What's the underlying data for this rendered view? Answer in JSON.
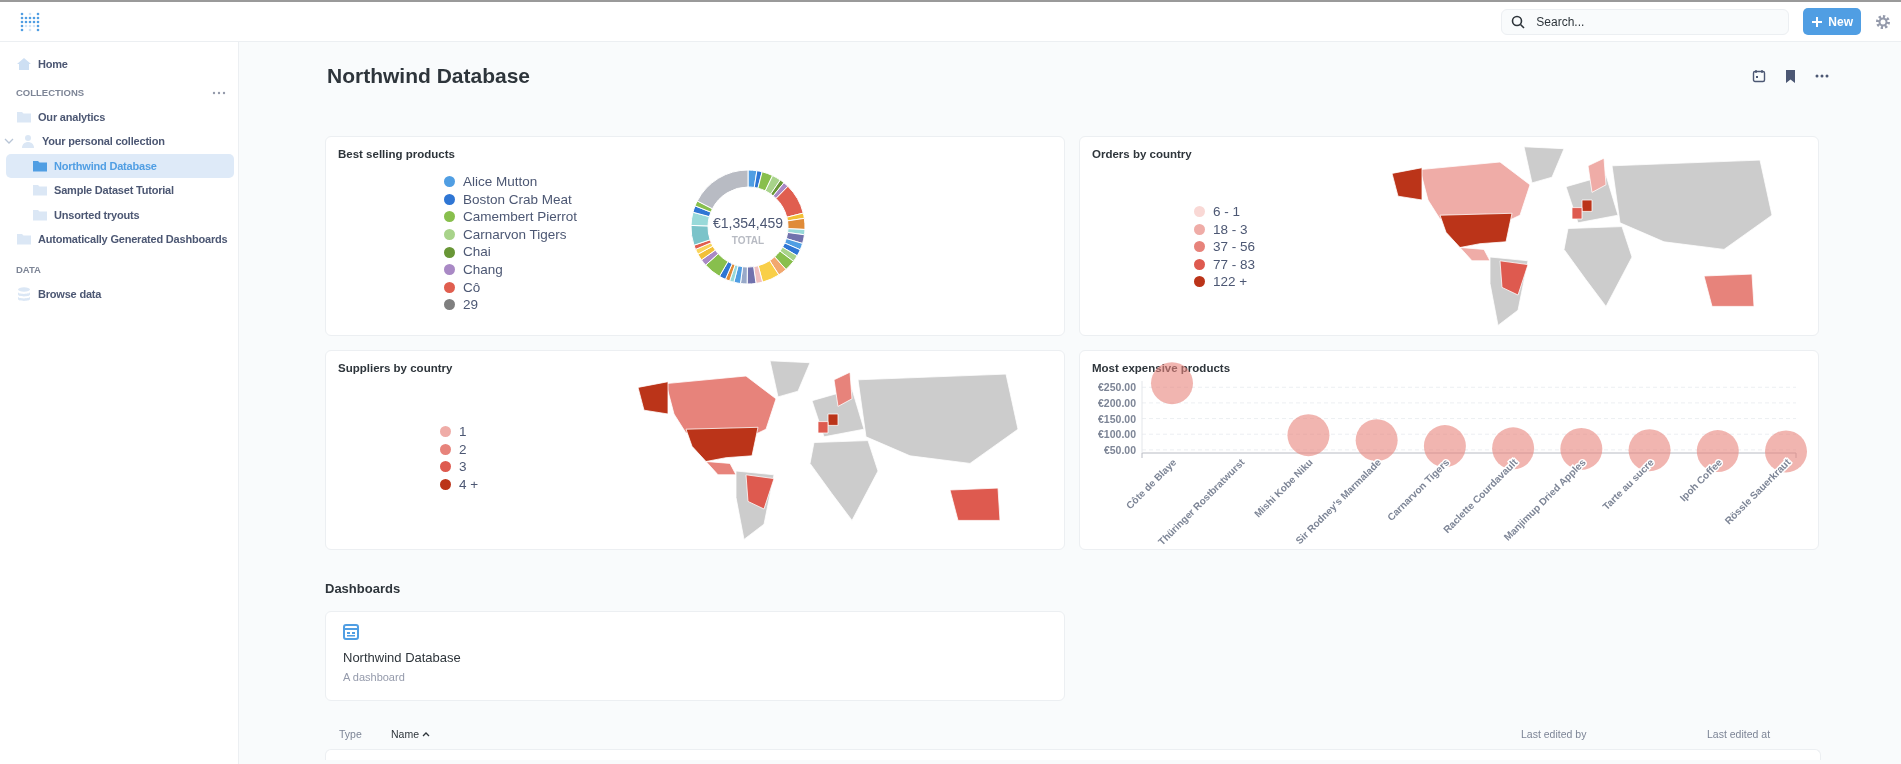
{
  "topbar": {
    "search": {
      "placeholder": "Search..."
    },
    "new_button": "New"
  },
  "sidebar": {
    "home": {
      "label": "Home"
    },
    "collections": {
      "heading": "COLLECTIONS",
      "items": [
        {
          "label": "Our analytics",
          "kind": "folder",
          "selected": false
        },
        {
          "label": "Your personal collection",
          "kind": "person",
          "selected": false,
          "expanded": true,
          "children": [
            {
              "label": "Northwind Database",
              "kind": "folder",
              "selected": true
            },
            {
              "label": "Sample Dataset Tutorial",
              "kind": "folder",
              "selected": false
            },
            {
              "label": "Unsorted tryouts",
              "kind": "folder",
              "selected": false
            }
          ]
        },
        {
          "label": "Automatically Generated Dashboards",
          "kind": "folder",
          "selected": false
        }
      ]
    },
    "data": {
      "heading": "DATA",
      "items": [
        {
          "label": "Browse data",
          "kind": "database",
          "selected": false
        }
      ]
    }
  },
  "dashboard": {
    "title": "Northwind Database",
    "cards": [
      {
        "kind": "donut",
        "title": "Best selling products",
        "total": "€1,354,459",
        "total_label": "TOTAL",
        "legend": [
          {
            "label": "Alice Mutton",
            "color": "#509ee3"
          },
          {
            "label": "Boston Crab Meat",
            "color": "#2f76d4"
          },
          {
            "label": "Camembert Pierrot",
            "color": "#88bf4d"
          },
          {
            "label": "Carnarvon Tigers",
            "color": "#a8d38a"
          },
          {
            "label": "Chai",
            "color": "#689636"
          },
          {
            "label": "Chang",
            "color": "#a989c5"
          },
          {
            "label": "Cô",
            "color": "#e05e4f"
          },
          {
            "label": "29",
            "color": "#7f7f7f"
          }
        ]
      },
      {
        "kind": "map",
        "title": "Orders by country",
        "legend": [
          {
            "label": "6 - 1",
            "color": "#f9d8d5"
          },
          {
            "label": "18 - 3",
            "color": "#efaca7"
          },
          {
            "label": "37 - 56",
            "color": "#e7837b"
          },
          {
            "label": "77 - 83",
            "color": "#de5a4f"
          },
          {
            "label": "122 +",
            "color": "#bb3419"
          }
        ]
      },
      {
        "kind": "map",
        "title": "Suppliers by country",
        "legend": [
          {
            "label": "1",
            "color": "#efaca7"
          },
          {
            "label": "2",
            "color": "#e7837b"
          },
          {
            "label": "3",
            "color": "#de5a4f"
          },
          {
            "label": "4 +",
            "color": "#bb3419"
          }
        ]
      },
      {
        "kind": "bubble",
        "title": "Most expensive products",
        "chart_data": {
          "type": "scatter",
          "categories": [
            "Côte de Blaye",
            "Thüringer Rostbratwurst",
            "Mishi Kobe Niku",
            "Sir Rodney's Marmalade",
            "Carnarvon Tigers",
            "Raclette Courdavault",
            "Manjimup Dried Apples",
            "Tarte au sucre",
            "Ipoh Coffee",
            "Rössle Sauerkraut"
          ],
          "series": [
            {
              "color": "#e7837b",
              "values": [
                263,
                null,
                97,
                81,
                62,
                55,
                53,
                49,
                46,
                45
              ]
            }
          ],
          "grid": true,
          "ylim": [
            40,
            270
          ],
          "yticks": [
            {
              "value": 50,
              "label": "€50.00"
            },
            {
              "value": 100,
              "label": "€100.00"
            },
            {
              "value": 150,
              "label": "€150.00"
            },
            {
              "value": 200,
              "label": "€200.00"
            },
            {
              "value": 250,
              "label": "€250.00"
            }
          ]
        }
      }
    ]
  },
  "dashboards": {
    "heading": "Dashboards",
    "items": [
      {
        "title": "Northwind Database",
        "description": "A dashboard"
      }
    ]
  },
  "table": {
    "columns": [
      {
        "label": "Type",
        "sorted": false
      },
      {
        "label": "Name",
        "sorted": true
      },
      {
        "label": "Last edited by",
        "sorted": false
      },
      {
        "label": "Last edited at",
        "sorted": false
      }
    ]
  }
}
